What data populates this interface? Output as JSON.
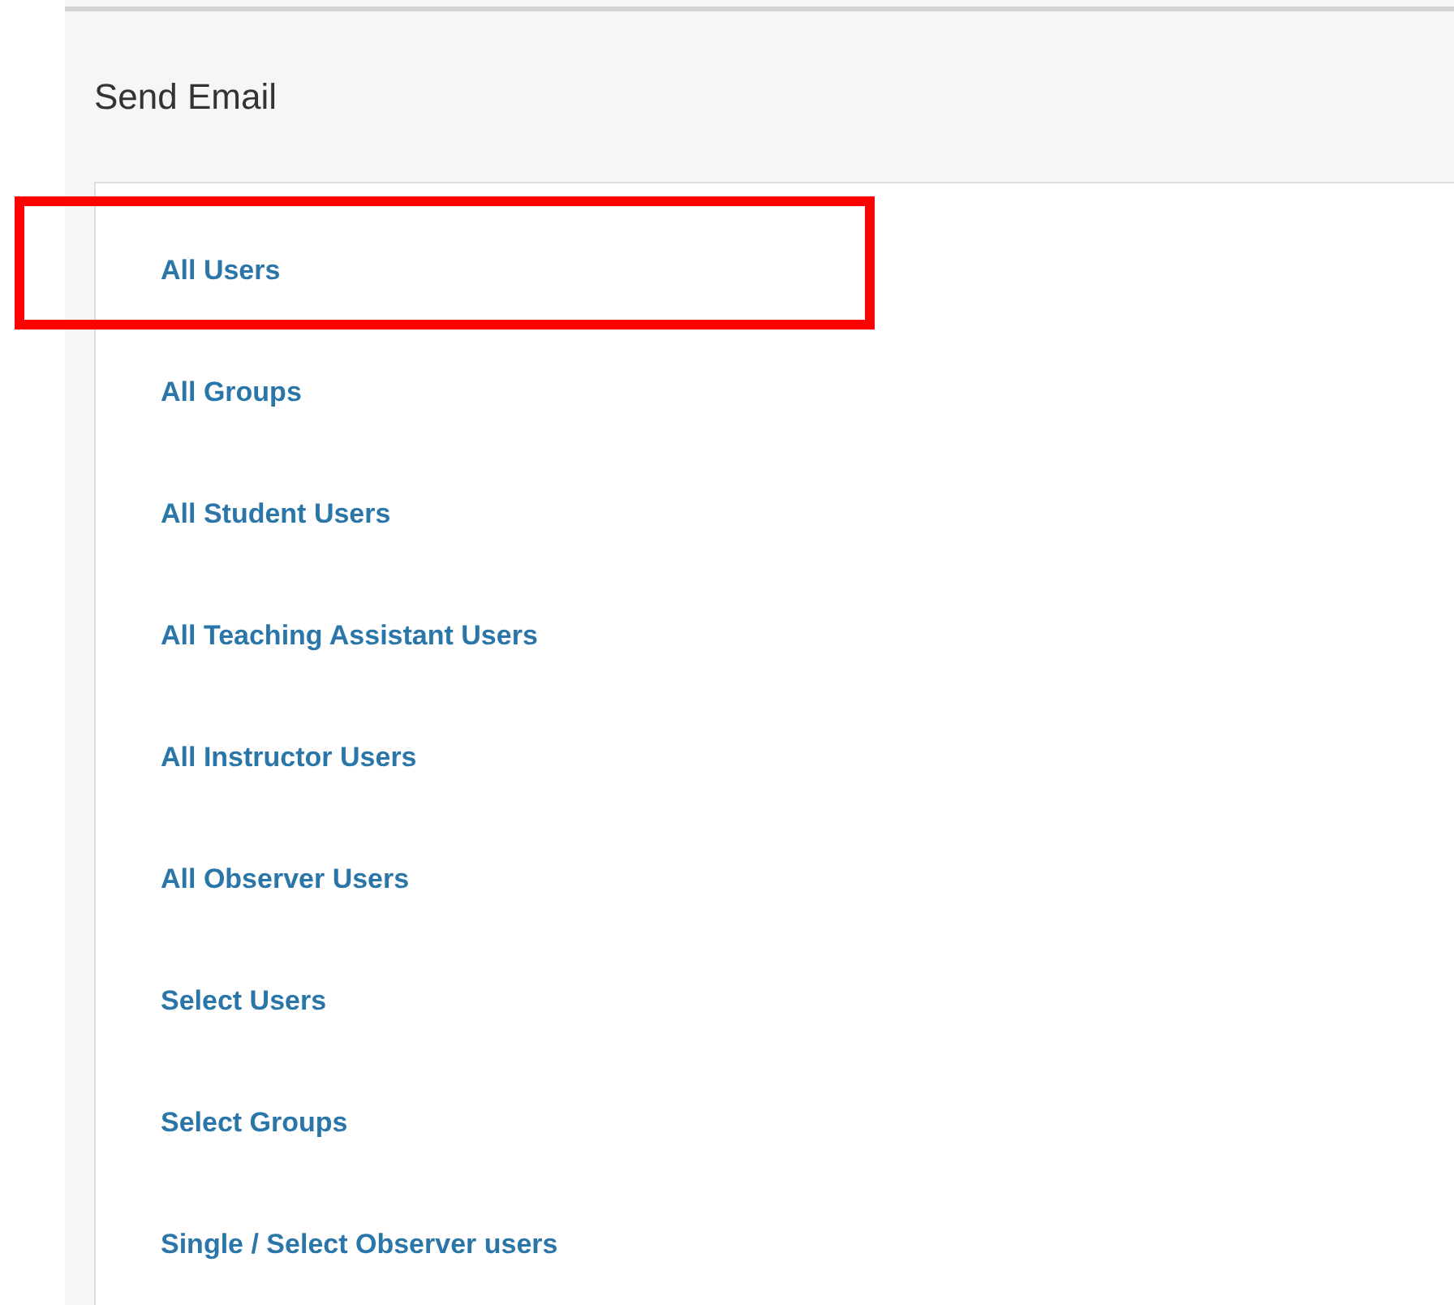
{
  "page": {
    "title": "Send Email"
  },
  "recipients": [
    {
      "label": "All Users",
      "highlighted": true
    },
    {
      "label": "All Groups",
      "highlighted": false
    },
    {
      "label": "All Student Users",
      "highlighted": false
    },
    {
      "label": "All Teaching Assistant Users",
      "highlighted": false
    },
    {
      "label": "All Instructor Users",
      "highlighted": false
    },
    {
      "label": "All Observer Users",
      "highlighted": false
    },
    {
      "label": "Select Users",
      "highlighted": false
    },
    {
      "label": "Select Groups",
      "highlighted": false
    },
    {
      "label": "Single / Select Observer users",
      "highlighted": false
    }
  ]
}
